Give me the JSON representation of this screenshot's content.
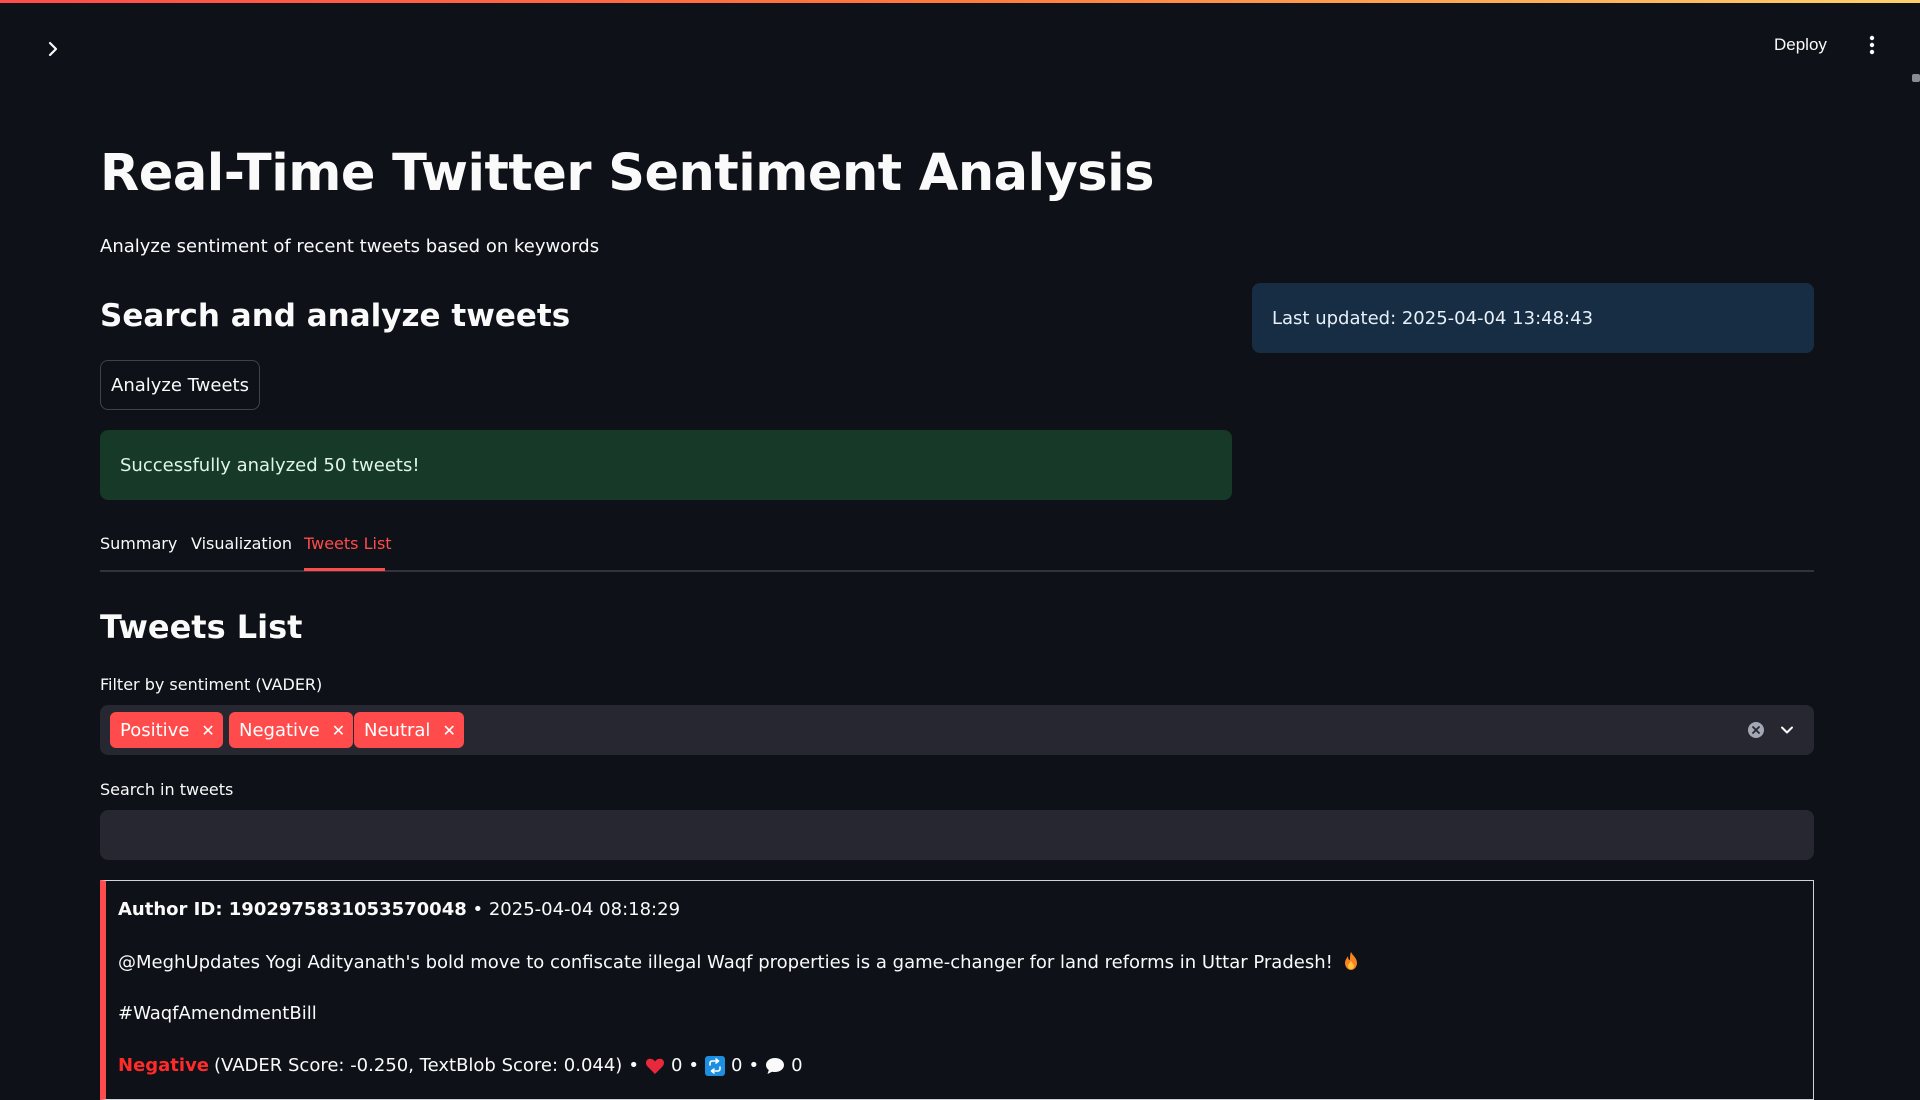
{
  "app": {
    "accent": "#ff4b4b",
    "deploy_label": "Deploy"
  },
  "header": {
    "title": "Real-Time Twitter Sentiment Analysis",
    "subtitle": "Analyze sentiment of recent tweets based on keywords"
  },
  "search_section": {
    "heading": "Search and analyze tweets",
    "analyze_button": "Analyze Tweets",
    "last_updated": "Last updated: 2025-04-04 13:48:43",
    "success_message": "Successfully analyzed 50 tweets!"
  },
  "tabs": [
    {
      "label": "Summary",
      "active": false
    },
    {
      "label": "Visualization",
      "active": false
    },
    {
      "label": "Tweets List",
      "active": true
    }
  ],
  "tweets_list": {
    "heading": "Tweets List",
    "filter_label": "Filter by sentiment (VADER)",
    "filter_chips": [
      "Positive",
      "Negative",
      "Neutral"
    ],
    "search_label": "Search in tweets",
    "search_value": "",
    "search_placeholder": ""
  },
  "tweets": [
    {
      "author_label": "Author ID: 1902975831053570048",
      "separator": "•",
      "timestamp": "2025-04-04 08:18:29",
      "text": "@MeghUpdates Yogi Adityanath's bold move to confiscate illegal Waqf properties is a game-changer for land reforms in Uttar Pradesh!",
      "emoji_icon": "fire-icon",
      "hashtag": "#WaqfAmendmentBill",
      "sentiment": "Negative",
      "sentiment_color": "#ff2b2b",
      "scores": "(VADER Score: -0.250, TextBlob Score: 0.044)",
      "likes": "0",
      "retweets": "0",
      "replies": "0"
    }
  ]
}
